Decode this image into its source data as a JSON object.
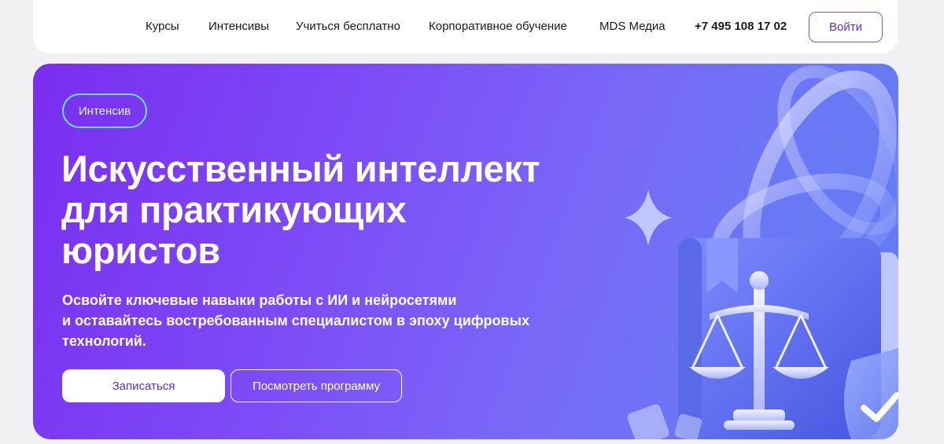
{
  "nav": {
    "items": [
      {
        "label": "Курсы"
      },
      {
        "label": "Интенсивы"
      },
      {
        "label": "Учиться бесплатно"
      },
      {
        "label": "Корпоративное обучение"
      },
      {
        "label": "MDS Медиа"
      }
    ],
    "phone": "+7 495 108 17 02",
    "login_label": "Войти"
  },
  "hero": {
    "badge": "Интенсив",
    "title_lines": [
      "Искусственный интеллект",
      "для практикующих",
      "юристов"
    ],
    "subtitle_lines": [
      "Освойте ключевые навыки работы с ИИ и нейросетями",
      "и оставайтесь востребованным специалистом в эпоху цифровых",
      "технологий."
    ],
    "primary_button": "Записаться",
    "secondary_button": "Посмотреть программу"
  },
  "colors": {
    "accent": "#7b4dff",
    "badge_border": "#5ee7e0",
    "hero_gradient_start": "#7a2df0",
    "hero_gradient_end": "#5f7df0"
  },
  "icons": {
    "illustration": "book-scales-illustration",
    "sparkle": "sparkle-icon",
    "shield": "shield-check-icon"
  }
}
